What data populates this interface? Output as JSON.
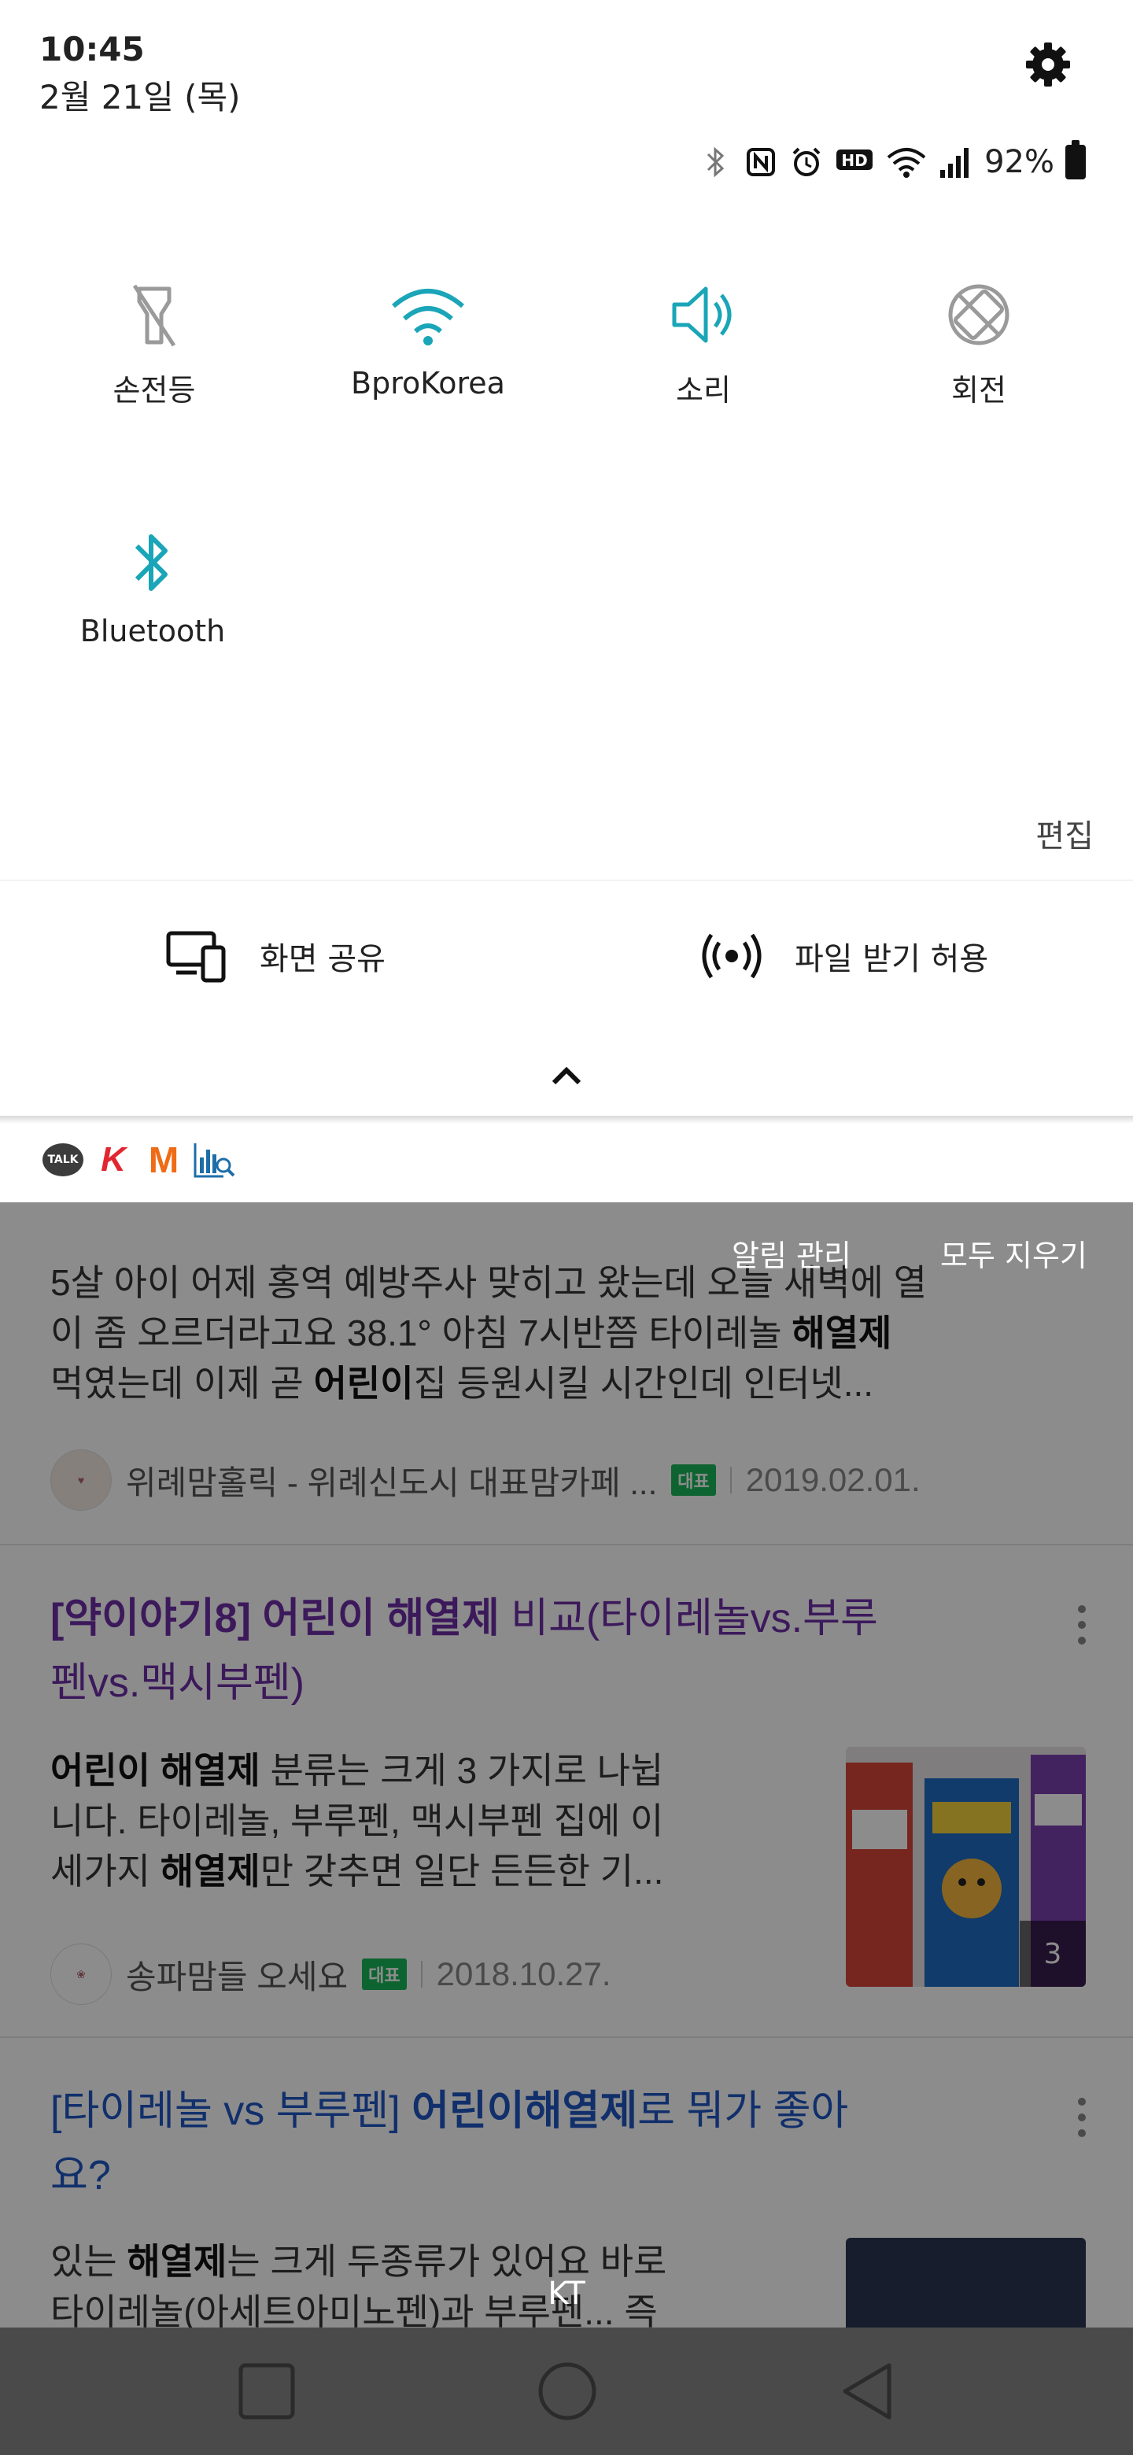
{
  "status": {
    "time": "10:45",
    "date": "2월 21일 (목)",
    "battery": "92%"
  },
  "quick_tiles": [
    {
      "label": "손전등",
      "icon": "flashlight-off-icon",
      "active": false
    },
    {
      "label": "BproKorea",
      "icon": "wifi-icon",
      "active": true
    },
    {
      "label": "소리",
      "icon": "sound-icon",
      "active": true
    },
    {
      "label": "회전",
      "icon": "rotation-lock-icon",
      "active": false
    },
    {
      "label": "Bluetooth",
      "icon": "bluetooth-icon",
      "active": true
    }
  ],
  "edit_label": "편집",
  "screen_share_label": "화면 공유",
  "file_receive_label": "파일 받기 허용",
  "notifications": {
    "manage": "알림 관리",
    "clear_all": "모두 지우기"
  },
  "results": [
    {
      "snippet_lines": [
        "5살 아이 어제 홍역 예방주사 맞히고 왔는데 오늘 새벽에 열",
        "이 좀 오르더라고요 38.1° 아침 7시반쯤 타이레놀 해열제",
        "먹였는데 이제 곧 어린이집 등원시킬 시간인데 인터넷..."
      ],
      "source": "위례맘홀릭 - 위례신도시 대표맘카페 ...",
      "badge": "대표",
      "date": "2019.02.01."
    },
    {
      "title_line1_bold": "[약이야기8] 어린이 해열제",
      "title_line1_rest": " 비교(타이레놀vs.부루",
      "title_line2": "펜vs.맥시부펜)",
      "snippet_lines": [
        "어린이 해열제 분류는 크게 3 가지로 나뉩",
        "니다. 타이레놀, 부루펜, 맥시부펜 집에 이",
        "세가지 해열제만 갖추면 일단 든든한 기..."
      ],
      "source": "송파맘들 오세요",
      "badge": "대표",
      "date": "2018.10.27.",
      "image_count": "3"
    },
    {
      "title_line1_a": "[타이레놀 vs 부루펜] ",
      "title_line1_bold": "어린이해열제",
      "title_line1_rest": "로 뭐가 좋아",
      "title_line2": "요?",
      "snippet_lines": [
        "있는 해열제는 크게 두종류가 있어요 바로",
        "타이레놀(아세트아미노펜)과 부루펜... 즉"
      ]
    }
  ],
  "carrier": "KT",
  "colors": {
    "accent": "#1aa5b8",
    "inactive": "#9a9a9a",
    "nav_bar": "#4a4a4a"
  }
}
